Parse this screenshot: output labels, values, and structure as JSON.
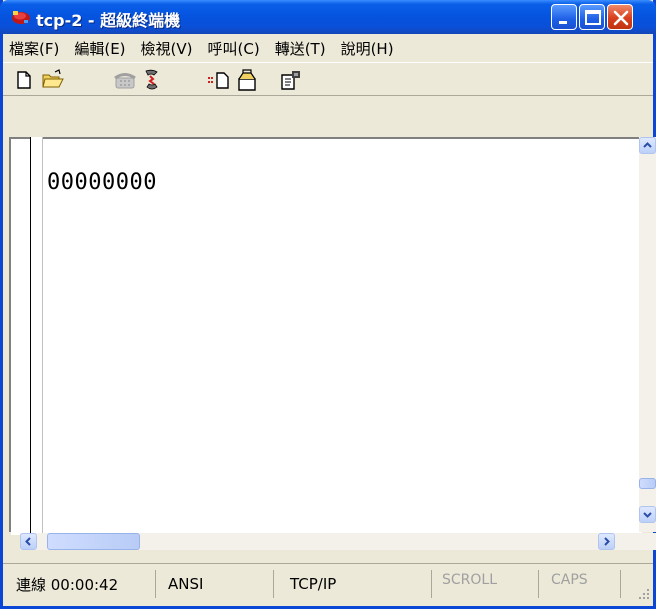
{
  "window": {
    "title": "tcp-2 - 超級終端機"
  },
  "menu": {
    "items": [
      "檔案(F)",
      "編輯(E)",
      "檢視(V)",
      "呼叫(C)",
      "轉送(T)",
      "說明(H)"
    ]
  },
  "toolbar": {
    "icons": [
      "new-icon",
      "open-icon",
      "call-icon",
      "disconnect-icon",
      "send-icon",
      "receive-icon",
      "properties-icon"
    ]
  },
  "terminal": {
    "text": "00000000"
  },
  "status": {
    "connection": "連線 00:00:42",
    "emulation": "ANSI",
    "transport": "TCP/IP",
    "scroll": "SCROLL",
    "caps": "CAPS"
  },
  "colors": {
    "titlebar": "#0554e0",
    "close_button": "#d8401c",
    "chrome": "#ece9d8"
  }
}
